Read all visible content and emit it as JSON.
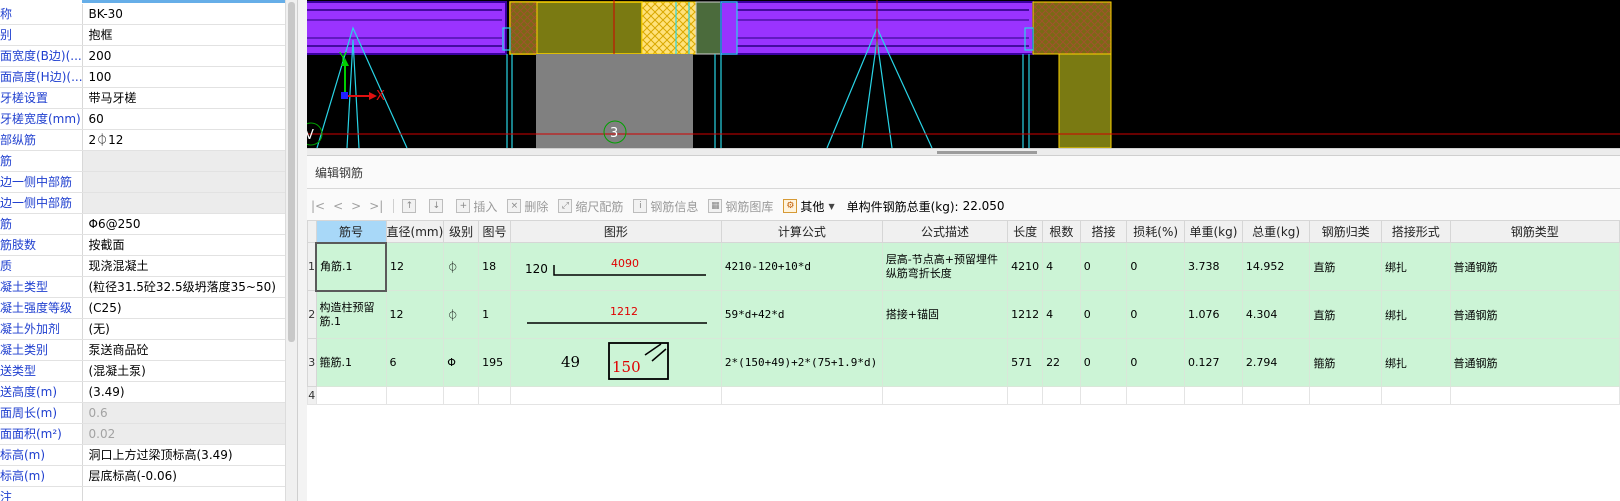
{
  "properties": [
    {
      "key": "称",
      "value": "BK-30",
      "style": "normal"
    },
    {
      "key": "别",
      "value": "抱框",
      "style": "normal"
    },
    {
      "key": "面宽度(B边)(...",
      "value": "200",
      "style": "normal"
    },
    {
      "key": "面高度(H边)(...",
      "value": "100",
      "style": "normal"
    },
    {
      "key": "牙槎设置",
      "value": "带马牙槎",
      "style": "normal"
    },
    {
      "key": "牙槎宽度(mm)",
      "value": "60",
      "style": "normal"
    },
    {
      "key": "部纵筋",
      "value": "2⏀12",
      "style": "normal"
    },
    {
      "key": "筋",
      "value": "",
      "style": "gray"
    },
    {
      "key": "边一侧中部筋",
      "value": "",
      "style": "gray"
    },
    {
      "key": "边一侧中部筋",
      "value": "",
      "style": "gray"
    },
    {
      "key": "筋",
      "value": "Φ6@250",
      "style": "normal"
    },
    {
      "key": "筋肢数",
      "value": "按截面",
      "style": "normal"
    },
    {
      "key": "质",
      "value": "现浇混凝土",
      "style": "normal"
    },
    {
      "key": "凝土类型",
      "value": "(粒径31.5砼32.5级坍落度35~50)",
      "style": "normal"
    },
    {
      "key": "凝土强度等级",
      "value": "(C25)",
      "style": "normal"
    },
    {
      "key": "凝土外加剂",
      "value": "(无)",
      "style": "normal"
    },
    {
      "key": "凝土类别",
      "value": "泵送商品砼",
      "style": "normal"
    },
    {
      "key": "送类型",
      "value": "(混凝土泵)",
      "style": "normal"
    },
    {
      "key": "送高度(m)",
      "value": "(3.49)",
      "style": "normal"
    },
    {
      "key": "面周长(m)",
      "value": "0.6",
      "style": "dim"
    },
    {
      "key": "面面积(m²)",
      "value": "0.02",
      "style": "dim"
    },
    {
      "key": "标高(m)",
      "value": "洞口上方过梁顶标高(3.49)",
      "style": "normal"
    },
    {
      "key": "标高(m)",
      "value": "层底标高(-0.06)",
      "style": "normal"
    },
    {
      "key": "注",
      "value": "",
      "style": "normal"
    }
  ],
  "viewport": {
    "axis_x": "X",
    "axis_y": "Y",
    "marker_v": "V",
    "marker_3": "3",
    "colors": {
      "purple": "#9a33ff",
      "olive": "#7a7a12",
      "cyan": "#29d4e6",
      "red": "#d00000",
      "yellow": "#ffd400",
      "gray": "#808080"
    }
  },
  "editor": {
    "title": "编辑钢筋",
    "toolbar": {
      "nav_first": "|<",
      "nav_prev": "<",
      "nav_next": ">",
      "nav_last": ">|",
      "insert": "插入",
      "delete": "删除",
      "scale_rebar": "缩尺配筋",
      "rebar_info": "钢筋信息",
      "rebar_library": "钢筋图库",
      "other": "其他",
      "total_label": "单构件钢筋总重(kg):",
      "total_value": "22.050"
    },
    "columns": [
      "筋号",
      "直径(mm)",
      "级别",
      "图号",
      "图形",
      "计算公式",
      "公式描述",
      "长度",
      "根数",
      "搭接",
      "损耗(%)",
      "单重(kg)",
      "总重(kg)",
      "钢筋归类",
      "搭接形式",
      "钢筋类型"
    ],
    "rows": [
      {
        "num": "1",
        "name": "角筋.1",
        "dia": "12",
        "grade": "⏀",
        "fig": "18",
        "shape_left": "120",
        "shape_main": "4090",
        "formula": "4210-120+10*d",
        "desc": "层高-节点高+预留埋件纵筋弯折长度",
        "length": "4210",
        "count": "4",
        "lap": "0",
        "loss": "0",
        "unit_wt": "3.738",
        "total_wt": "14.952",
        "category": "直筋",
        "lap_type": "绑扎",
        "type": "普通钢筋"
      },
      {
        "num": "2",
        "name": "构造柱预留筋.1",
        "dia": "12",
        "grade": "⏀",
        "fig": "1",
        "shape_left": "",
        "shape_main": "1212",
        "formula": "59*d+42*d",
        "desc": "搭接+锚固",
        "length": "1212",
        "count": "4",
        "lap": "0",
        "loss": "0",
        "unit_wt": "1.076",
        "total_wt": "4.304",
        "category": "直筋",
        "lap_type": "绑扎",
        "type": "普通钢筋"
      },
      {
        "num": "3",
        "name": "箍筋.1",
        "dia": "6",
        "grade": "Φ",
        "fig": "195",
        "shape_left": "49",
        "shape_main": "150",
        "formula": "2*(150+49)+2*(75+1.9*d)",
        "desc": "",
        "length": "571",
        "count": "22",
        "lap": "0",
        "loss": "0",
        "unit_wt": "0.127",
        "total_wt": "2.794",
        "category": "箍筋",
        "lap_type": "绑扎",
        "type": "普通钢筋"
      }
    ],
    "empty_row_num": "4"
  }
}
